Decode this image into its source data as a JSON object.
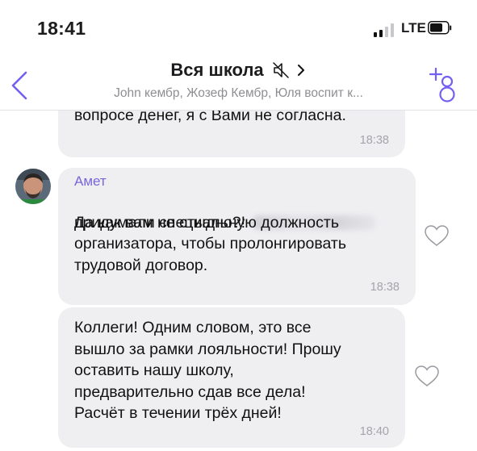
{
  "status_bar": {
    "time": "18:41",
    "network": "LTE"
  },
  "header": {
    "title": "Вся школа",
    "subtitle": "John кембр, Жозеф Кембр, Юля воспит к..."
  },
  "messages": [
    {
      "text": "вопросе денег, я с Вами не согласна.",
      "time": "18:38"
    },
    {
      "sender": "Амет",
      "text_first_line": "Да как вам не стыдно?!",
      "text_rest": "придумали специальную должность\nорганизатора, чтобы пролонгировать\nтрудовой договор.",
      "time": "18:38"
    },
    {
      "text": "Коллеги! Одним словом, это все\nвышло за рамки лояльности! Прошу\nоставить нашу школу,\nпредварительно сдав все дела!\nРасчёт в течении трёх дней!",
      "time": "18:40"
    }
  ],
  "colors": {
    "accent": "#7360f2",
    "bubble": "#efeff2",
    "sender": "#7a65d8",
    "meta": "#8e8e93"
  },
  "icons": [
    "signal-icon",
    "battery-icon",
    "back-icon",
    "mute-icon",
    "chevron-right-icon",
    "add-member-icon",
    "like-icon"
  ]
}
